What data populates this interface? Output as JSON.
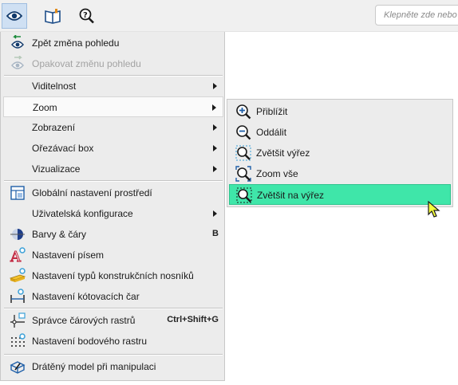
{
  "toolbar": {
    "search_placeholder": "Klepněte zde nebo"
  },
  "main_menu": {
    "items": [
      {
        "label": "Zpět změna pohledu",
        "icon": "undo-view-icon"
      },
      {
        "label": "Opakovat změnu pohledu",
        "icon": "redo-view-icon",
        "disabled": true
      },
      {
        "label": "Viditelnost",
        "submenu": true
      },
      {
        "label": "Zoom",
        "submenu": true,
        "highlighted": true
      },
      {
        "label": "Zobrazení",
        "submenu": true
      },
      {
        "label": "Ořezávací box",
        "submenu": true
      },
      {
        "label": "Vizualizace",
        "submenu": true
      },
      {
        "label": "Globální nastavení prostředí",
        "icon": "global-settings-icon"
      },
      {
        "label": "Uživatelská konfigurace",
        "submenu": true
      },
      {
        "label": "Barvy & čáry",
        "icon": "colors-lines-icon",
        "shortcut": "B"
      },
      {
        "label": "Nastavení písem",
        "icon": "font-settings-icon"
      },
      {
        "label": "Nastavení typů konstrukčních nosníků",
        "icon": "beam-types-icon"
      },
      {
        "label": "Nastavení kótovacích čar",
        "icon": "dimension-lines-icon"
      },
      {
        "label": "Správce čárových rastrů",
        "icon": "line-grid-icon",
        "shortcut": "Ctrl+Shift+G"
      },
      {
        "label": "Nastavení bodového rastru",
        "icon": "point-grid-icon"
      },
      {
        "label": "Drátěný model při manipulaci",
        "icon": "wireframe-icon"
      }
    ]
  },
  "submenu": {
    "items": [
      {
        "label": "Přiblížit",
        "icon": "zoom-in-icon"
      },
      {
        "label": "Oddálit",
        "icon": "zoom-out-icon"
      },
      {
        "label": "Zvětšit výřez",
        "icon": "zoom-window-icon"
      },
      {
        "label": "Zoom vše",
        "icon": "zoom-all-icon"
      },
      {
        "label": "Zvětšit na výřez",
        "icon": "zoom-to-selection-icon",
        "active": true
      }
    ]
  },
  "colors": {
    "active_item": "#3fe6a9",
    "menu_bg": "#ececec",
    "icon_blue": "#1f5fa8"
  }
}
